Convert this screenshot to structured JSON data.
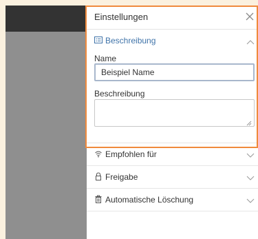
{
  "panel": {
    "title": "Einstellungen",
    "close_icon": "close-icon"
  },
  "sections": {
    "beschreibung": {
      "label": "Beschreibung",
      "icon": "description-icon",
      "expanded": true
    },
    "empfohlen": {
      "label": "Empfohlen für",
      "icon": "recommend-icon",
      "expanded": false
    },
    "freigabe": {
      "label": "Freigabe",
      "icon": "lock-icon",
      "expanded": false
    },
    "loeschung": {
      "label": "Automatische Löschung",
      "icon": "trash-icon",
      "expanded": false
    }
  },
  "form": {
    "name_label": "Name",
    "name_value": "Beispiel Name",
    "description_label": "Beschreibung",
    "description_value": ""
  },
  "colors": {
    "accent": "#3f73a9",
    "highlight": "#f08a3c",
    "background": "#fbf1df"
  }
}
